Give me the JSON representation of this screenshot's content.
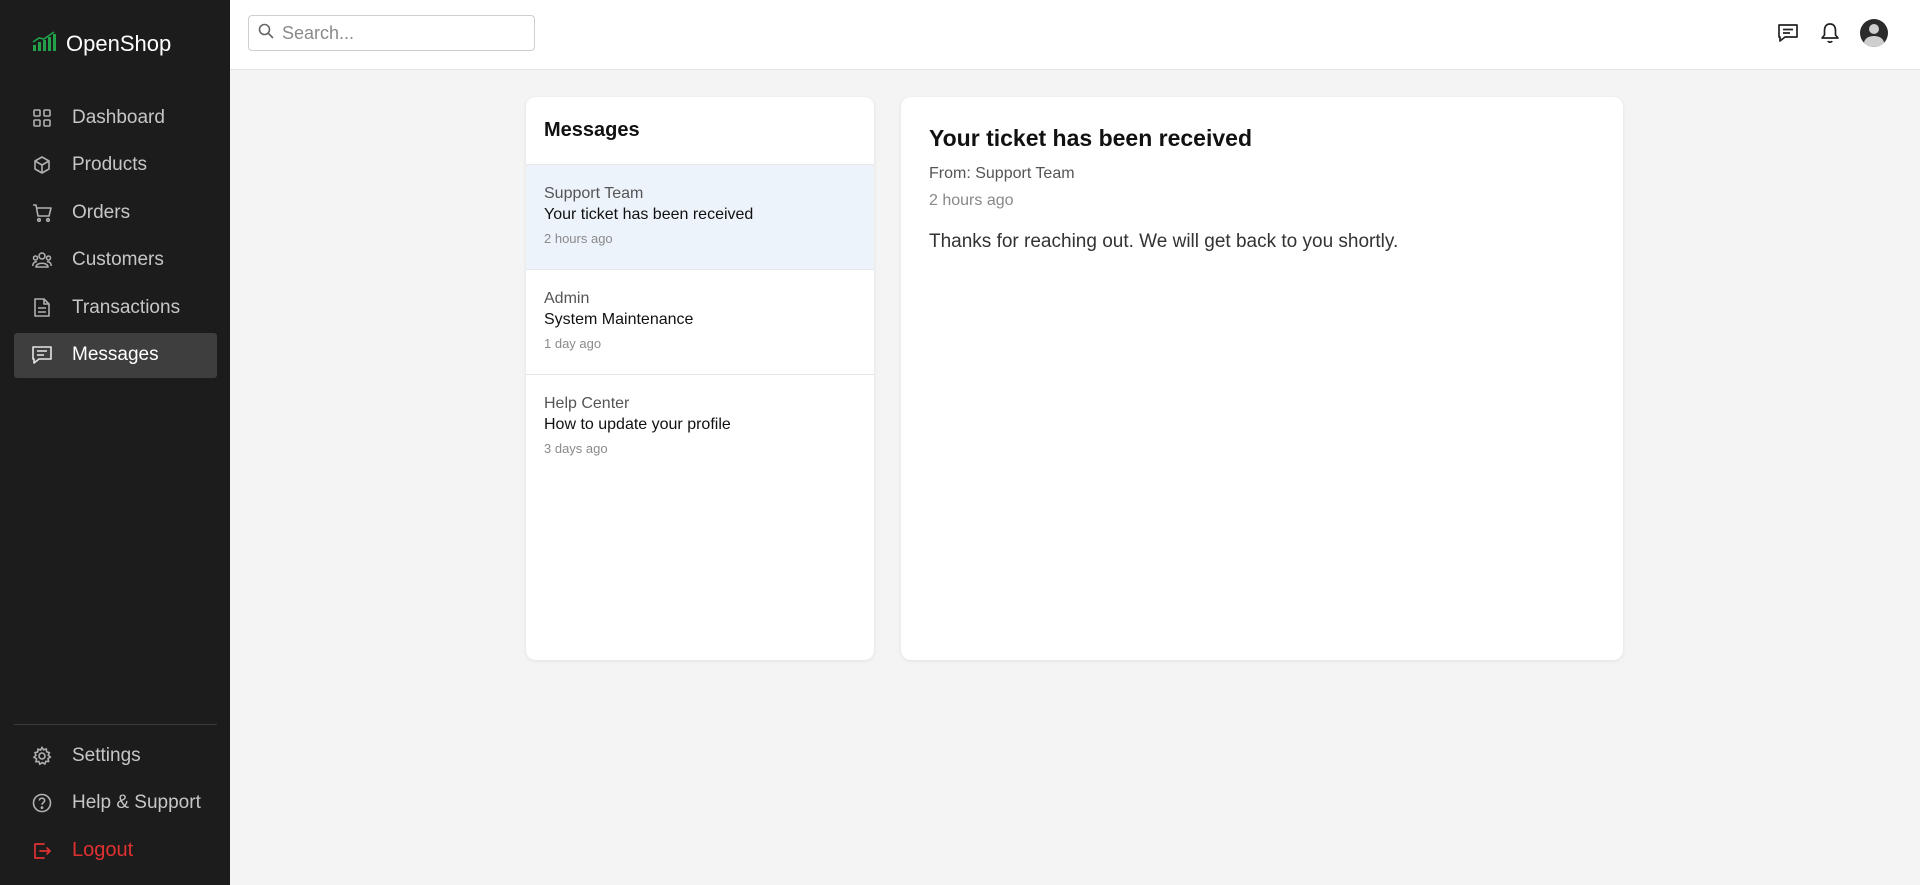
{
  "brand": {
    "name": "OpenShop",
    "icon": "chart-bars-icon",
    "accent": "#22a04a"
  },
  "search": {
    "placeholder": "Search..."
  },
  "sidebar": {
    "items": [
      {
        "label": "Dashboard",
        "icon": "grid-icon"
      },
      {
        "label": "Products",
        "icon": "box-icon"
      },
      {
        "label": "Orders",
        "icon": "cart-icon"
      },
      {
        "label": "Customers",
        "icon": "users-icon"
      },
      {
        "label": "Transactions",
        "icon": "document-icon"
      },
      {
        "label": "Messages",
        "icon": "message-icon",
        "active": true
      }
    ],
    "bottom": [
      {
        "label": "Settings",
        "icon": "gear-icon"
      },
      {
        "label": "Help & Support",
        "icon": "help-icon"
      },
      {
        "label": "Logout",
        "icon": "logout-icon",
        "color": "#e03131"
      }
    ]
  },
  "messages": {
    "title": "Messages",
    "items": [
      {
        "sender": "Support Team",
        "subject": "Your ticket has been received",
        "time": "2 hours ago",
        "selected": true
      },
      {
        "sender": "Admin",
        "subject": "System Maintenance",
        "time": "1 day ago"
      },
      {
        "sender": "Help Center",
        "subject": "How to update your profile",
        "time": "3 days ago"
      }
    ]
  },
  "detail": {
    "title": "Your ticket has been received",
    "from": "From: Support Team",
    "time": "2 hours ago",
    "body": "Thanks for reaching out. We will get back to you shortly."
  }
}
